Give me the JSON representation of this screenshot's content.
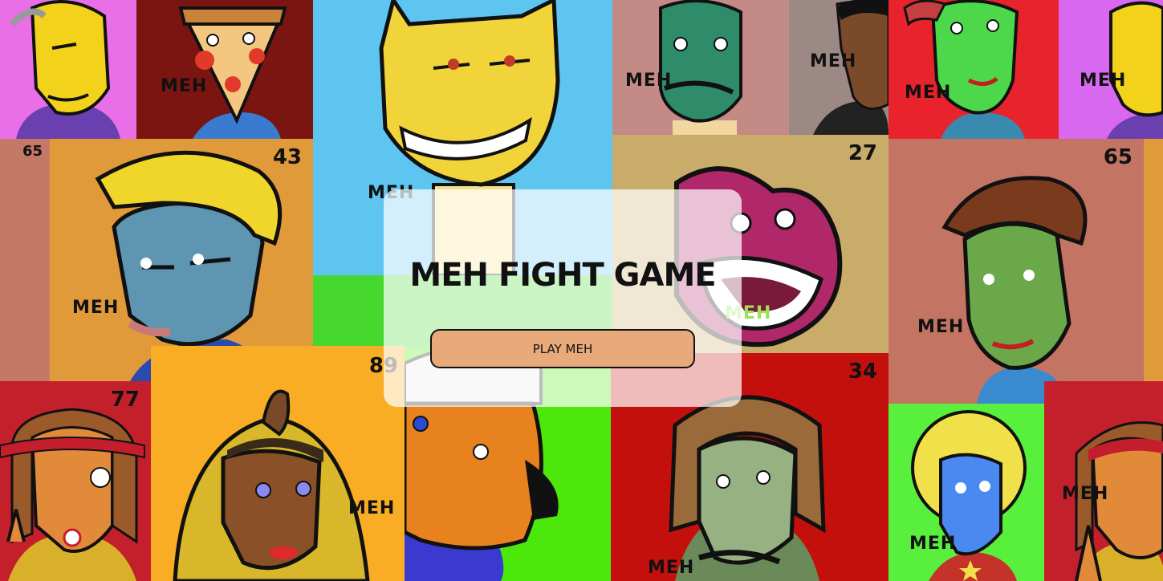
{
  "game": {
    "title": "MEH FIGHT GAME",
    "play_label": "PLAY MEH"
  },
  "background_tiles": [
    {
      "id": "t1",
      "character": "yellow-face-purple-hoodie",
      "number": "",
      "tag": "MEH",
      "color": "#e86fe8"
    },
    {
      "id": "t2",
      "character": "pizza-slice-face",
      "number": "",
      "tag": "MEH",
      "color": "#7a1512"
    },
    {
      "id": "t3",
      "character": "yellow-cat-grinning",
      "number": "",
      "tag": "MEH",
      "color": "#5ec4f0"
    },
    {
      "id": "t4",
      "character": "green-mustache-face",
      "number": "",
      "tag": "MEH",
      "color": "#c48a86"
    },
    {
      "id": "t5",
      "character": "dark-skin-man",
      "number": "",
      "tag": "MEH",
      "color": "#9c8884"
    },
    {
      "id": "t6",
      "character": "green-face-red-cap",
      "number": "",
      "tag": "MEH",
      "color": "#e8232b"
    },
    {
      "id": "t7",
      "character": "yellow-face-purple-hoodie",
      "number": "",
      "tag": "MEH",
      "color": "#d868f0"
    },
    {
      "id": "t9",
      "character": "blue-face-blond-hair",
      "number": "43",
      "tag": "MEH",
      "color": "#e09a3a"
    },
    {
      "id": "t8",
      "character": "edge-tile",
      "number": "65",
      "tag": "",
      "color": "#c47866"
    },
    {
      "id": "t10",
      "character": "pink-monster-mouth",
      "number": "27",
      "tag": "MEH",
      "color": "#c9ac6a"
    },
    {
      "id": "t11",
      "character": "green-face-brown-hair",
      "number": "65",
      "tag": "MEH",
      "color": "#c47462"
    },
    {
      "id": "t12",
      "character": "hippie-peace-sign",
      "number": "77",
      "tag": "",
      "color": "#c4202c"
    },
    {
      "id": "t13",
      "character": "egyptian-queen",
      "number": "89",
      "tag": "MEH",
      "color": "#f9ad24"
    },
    {
      "id": "t14",
      "character": "orange-face-white-hair",
      "number": "",
      "tag": "",
      "color": "#4ce80c"
    },
    {
      "id": "t15",
      "character": "green-face-long-hair-mustache",
      "number": "34",
      "tag": "MEH",
      "color": "#c4100c"
    },
    {
      "id": "t16",
      "character": "blue-face-afro",
      "number": "",
      "tag": "MEH",
      "color": "#58f03c"
    },
    {
      "id": "t17",
      "character": "hippie-peace-sign",
      "number": "",
      "tag": "MEH",
      "color": "#c4202c"
    }
  ],
  "colors": {
    "overlay": "rgba(255,255,255,0.72)",
    "button": "#e8aa7a",
    "text": "#111111"
  }
}
